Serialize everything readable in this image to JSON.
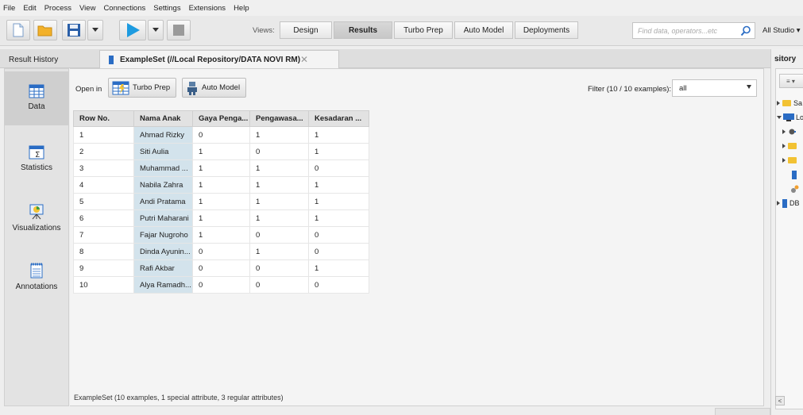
{
  "menubar": {
    "items": [
      "File",
      "Edit",
      "Process",
      "View",
      "Connections",
      "Settings",
      "Extensions",
      "Help"
    ]
  },
  "toolbar": {
    "views_label": "Views:",
    "views": [
      "Design",
      "Results",
      "Turbo Prep",
      "Auto Model",
      "Deployments"
    ],
    "active_view": "Results",
    "search_placeholder": "Find data, operators...etc",
    "studio_label": "All Studio ▾"
  },
  "tabs": {
    "result_history": "Result History",
    "exampleset_title": "ExampleSet (//Local Repository/DATA NOVI RM)",
    "close_symbol": "✕"
  },
  "sidebar": {
    "items": [
      {
        "label": "Data",
        "icon": "table-icon"
      },
      {
        "label": "Statistics",
        "icon": "statistics-icon"
      },
      {
        "label": "Visualizations",
        "icon": "visualizations-icon"
      },
      {
        "label": "Annotations",
        "icon": "annotations-icon"
      }
    ],
    "active": "Data"
  },
  "results": {
    "open_in_label": "Open in",
    "turbo_prep_button": "Turbo Prep",
    "auto_model_button": "Auto Model",
    "filter_label": "Filter (10 / 10 examples):",
    "filter_value": "all",
    "columns": [
      "Row No.",
      "Nama Anak",
      "Gaya Penga...",
      "Pengawasa...",
      "Kesadaran ..."
    ],
    "rows": [
      [
        "1",
        "Ahmad Rizky",
        "0",
        "1",
        "1"
      ],
      [
        "2",
        "Siti Aulia",
        "1",
        "0",
        "1"
      ],
      [
        "3",
        "Muhammad ...",
        "1",
        "1",
        "0"
      ],
      [
        "4",
        "Nabila Zahra",
        "1",
        "1",
        "1"
      ],
      [
        "5",
        "Andi Pratama",
        "1",
        "1",
        "1"
      ],
      [
        "6",
        "Putri Maharani",
        "1",
        "1",
        "1"
      ],
      [
        "7",
        "Fajar Nugroho",
        "1",
        "0",
        "0"
      ],
      [
        "8",
        "Dinda Ayunin...",
        "0",
        "1",
        "0"
      ],
      [
        "9",
        "Rafi Akbar",
        "0",
        "0",
        "1"
      ],
      [
        "10",
        "Alya Ramadh...",
        "0",
        "0",
        "0"
      ]
    ],
    "status_text": "ExampleSet (10 examples, 1 special attribute, 3 regular attributes)"
  },
  "repository": {
    "title": "sitory",
    "menu_button": "≡ ▾",
    "tree": [
      {
        "label": "Sa",
        "expanded": false,
        "indent": 0,
        "icon": "folder-icon"
      },
      {
        "label": "Loc",
        "expanded": true,
        "indent": 0,
        "icon": "local-repository-icon"
      },
      {
        "label": "",
        "expanded": false,
        "indent": 1,
        "icon": "connections-icon"
      },
      {
        "label": "",
        "expanded": false,
        "indent": 1,
        "icon": "folder-icon"
      },
      {
        "label": "",
        "expanded": false,
        "indent": 1,
        "icon": "folder-icon"
      },
      {
        "label": "",
        "expanded": null,
        "indent": 2,
        "icon": "data-icon"
      },
      {
        "label": "",
        "expanded": null,
        "indent": 2,
        "icon": "process-icon"
      },
      {
        "label": "DB",
        "expanded": false,
        "indent": 0,
        "icon": "db-icon"
      }
    ],
    "scroll_left": "<"
  },
  "colors": {
    "accent_blue": "#2a6cc4",
    "special_column": "#d3e3ec",
    "folder_yellow": "#f2c233",
    "play_blue": "#1d9be0"
  }
}
